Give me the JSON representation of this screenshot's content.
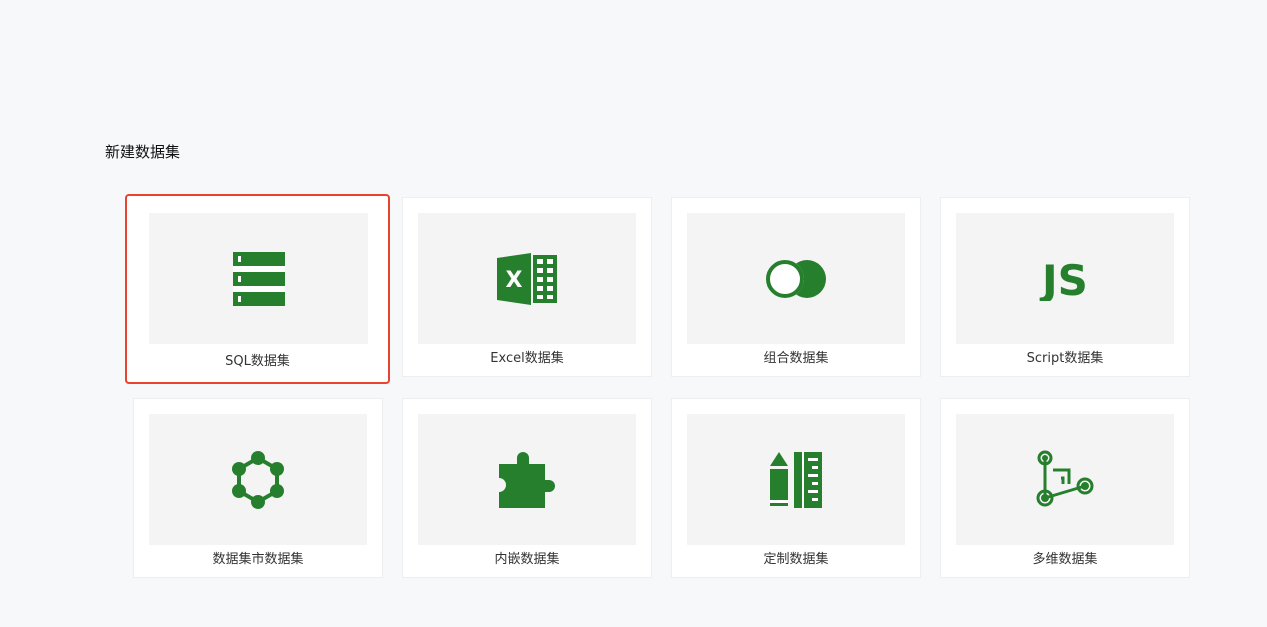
{
  "page": {
    "title": "新建数据集"
  },
  "colors": {
    "icon_green": "#267f2c",
    "selected_border": "#e8432e",
    "background": "#f7f8fa"
  },
  "cards": [
    {
      "label": "SQL数据集",
      "icon": "database-server-icon",
      "selected": true
    },
    {
      "label": "Excel数据集",
      "icon": "excel-icon",
      "selected": false
    },
    {
      "label": "组合数据集",
      "icon": "overlapping-circles-icon",
      "selected": false
    },
    {
      "label": "Script数据集",
      "icon": "javascript-icon",
      "selected": false
    },
    {
      "label": "数据集市数据集",
      "icon": "hexagon-network-icon",
      "selected": false
    },
    {
      "label": "内嵌数据集",
      "icon": "puzzle-piece-icon",
      "selected": false
    },
    {
      "label": "定制数据集",
      "icon": "pencil-ruler-icon",
      "selected": false
    },
    {
      "label": "多维数据集",
      "icon": "multidimensional-icon",
      "selected": false
    }
  ]
}
